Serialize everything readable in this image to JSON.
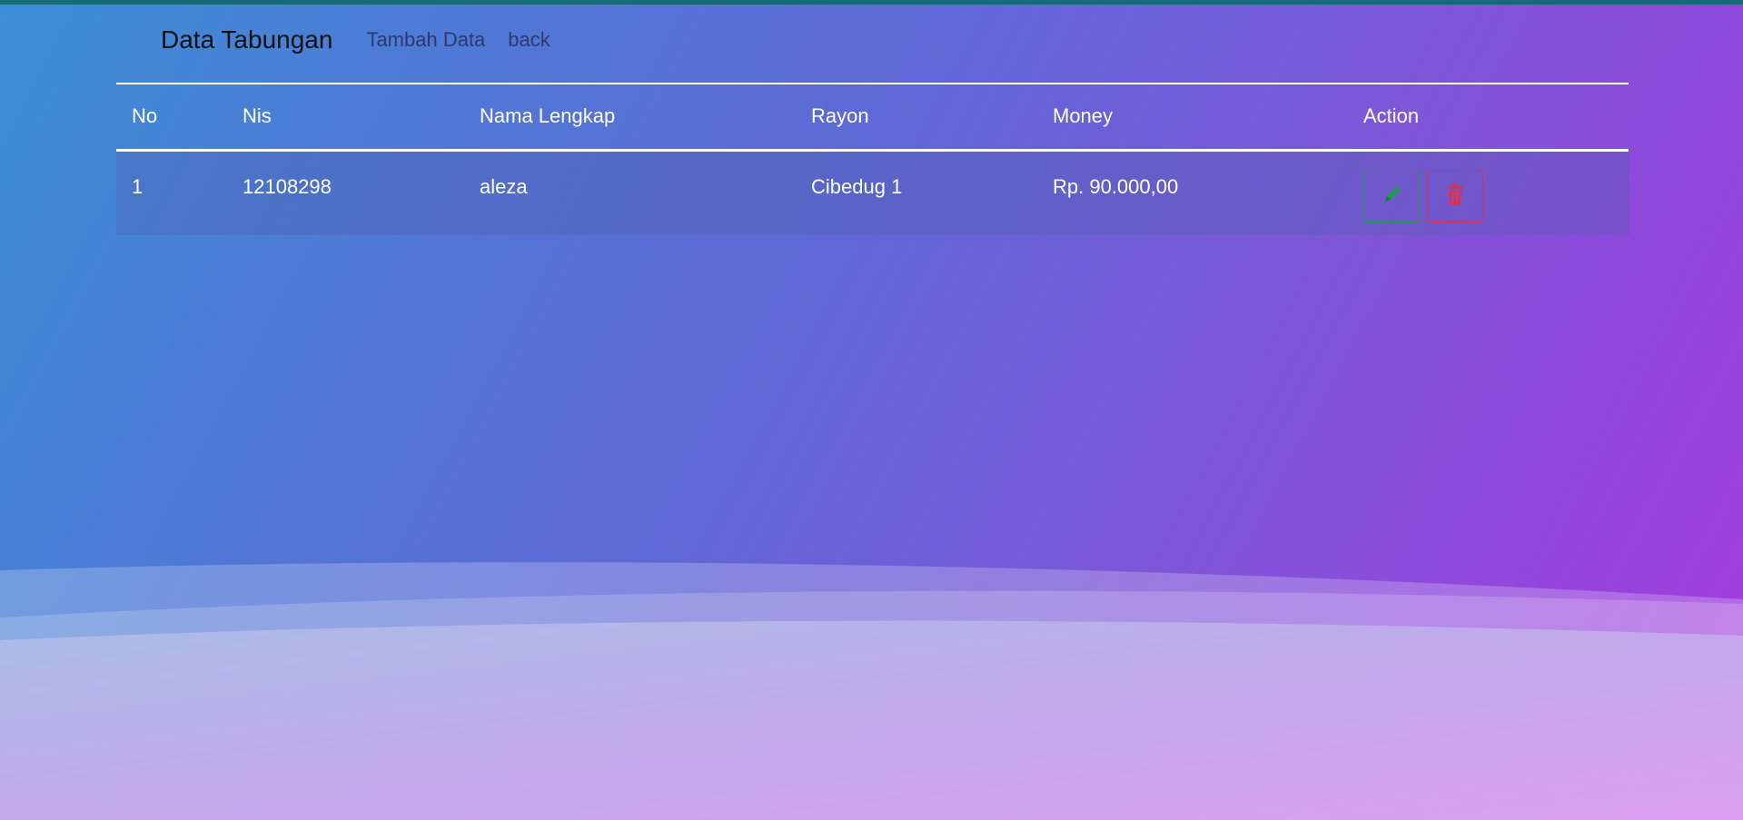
{
  "navbar": {
    "brand": "Data Tabungan",
    "links": [
      "Tambah Data",
      "back"
    ]
  },
  "table": {
    "headers": [
      "No",
      "Nis",
      "Nama Lengkap",
      "Rayon",
      "Money",
      "Action"
    ],
    "rows": [
      {
        "no": "1",
        "nis": "12108298",
        "nama": "aleza",
        "rayon": "Cibedug 1",
        "money": "Rp. 90.000,00",
        "actions": [
          "pencil-icon",
          "trash-icon"
        ]
      }
    ]
  },
  "colors": {
    "edit": "#1f9a4a",
    "delete": "#d9314f",
    "topbar": "#176a7a"
  }
}
